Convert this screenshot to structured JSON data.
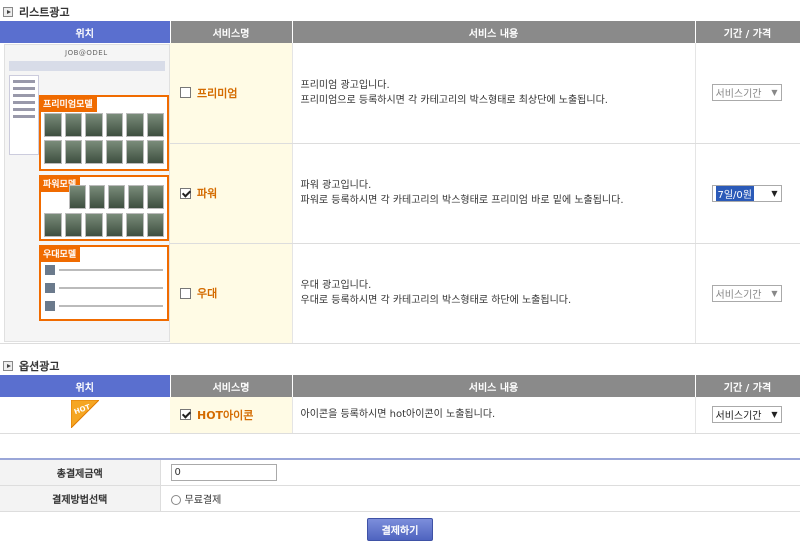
{
  "list_section": {
    "title": "리스트광고",
    "headers": {
      "location": "위치",
      "service_name": "서비스명",
      "service_content": "서비스 내용",
      "period_price": "기간 / 가격"
    },
    "preview": {
      "logo": "JOB@ODEL",
      "tags": {
        "premium": "프리미엄모델",
        "power": "파워모델",
        "special": "우대모델"
      }
    },
    "rows": [
      {
        "name": "프리미엄",
        "checked": false,
        "desc1": "프리미엄 광고입니다.",
        "desc2": "프리미엄으로 등록하시면 각 카테고리의 박스형태로 최상단에 노출됩니다.",
        "period": "서비스기간"
      },
      {
        "name": "파워",
        "checked": true,
        "desc1": "파워 광고입니다.",
        "desc2": "파워로 등록하시면 각 카테고리의 박스형태로 프리미엄 바로 밑에 노출됩니다.",
        "period": "7일/0원"
      },
      {
        "name": "우대",
        "checked": false,
        "desc1": "우대 광고입니다.",
        "desc2": "우대로 등록하시면 각 카테고리의 박스형태로 하단에 노출됩니다.",
        "period": "서비스기간"
      }
    ]
  },
  "option_section": {
    "title": "옵션광고",
    "headers": {
      "location": "위치",
      "service_name": "서비스명",
      "service_content": "서비스 내용",
      "period_price": "기간 / 가격"
    },
    "hot_badge": "HOT",
    "rows": [
      {
        "name": "HOT아이콘",
        "checked": true,
        "desc1": "아이콘을 등록하시면 hot아이콘이 노출됩니다.",
        "period": "서비스기간"
      }
    ]
  },
  "payment": {
    "total_label": "총결제금액",
    "total_value": "0",
    "method_label": "결제방법선택",
    "method_option": "무료결제",
    "submit_label": "결제하기"
  },
  "colors": {
    "accent": "#5a6fcf",
    "header_gray": "#8a8a8a",
    "orange": "#f06b00",
    "name_bg": "#fffbe5"
  }
}
